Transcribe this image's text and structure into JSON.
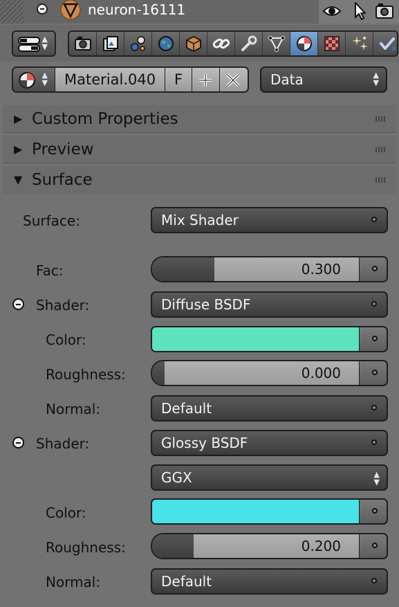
{
  "outliner": {
    "object_name": "neuron-16111"
  },
  "material": {
    "name": "Material.040",
    "fake_user_label": "F",
    "link_dropdown": "Data"
  },
  "panels": {
    "custom_properties": "Custom Properties",
    "preview": "Preview",
    "surface": "Surface"
  },
  "surface": {
    "surface_label": "Surface:",
    "surface_value": "Mix Shader",
    "fac_label": "Fac:",
    "fac_value": "0.300",
    "fac_fraction": 0.3,
    "shader1": {
      "label": "Shader:",
      "value": "Diffuse BSDF",
      "color_label": "Color:",
      "color": "#5de3bd",
      "roughness_label": "Roughness:",
      "roughness_value": "0.000",
      "roughness_fraction": 0.0,
      "normal_label": "Normal:",
      "normal_value": "Default"
    },
    "shader2": {
      "label": "Shader:",
      "value": "Glossy BSDF",
      "distribution": "GGX",
      "color_label": "Color:",
      "color": "#48e3e8",
      "roughness_label": "Roughness:",
      "roughness_value": "0.200",
      "roughness_fraction": 0.2,
      "normal_label": "Normal:",
      "normal_value": "Default"
    }
  },
  "icons": {
    "restrict": [
      "eye-icon",
      "cursor-icon",
      "camera-icon"
    ],
    "tabs": [
      "render-icon",
      "render-layers-icon",
      "scene-icon",
      "world-icon",
      "object-icon",
      "constraints-icon",
      "modifiers-icon",
      "data-icon",
      "material-icon",
      "texture-icon",
      "particles-icon",
      "physics-icon"
    ]
  }
}
